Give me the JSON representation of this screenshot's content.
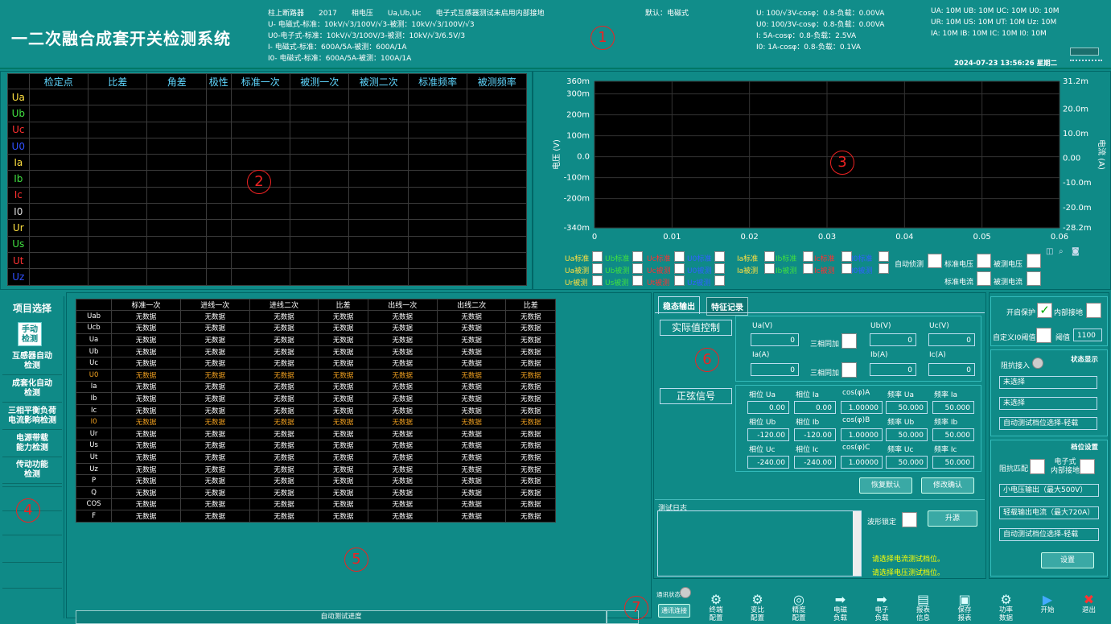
{
  "header": {
    "title": "一二次融合成套开关检测系统",
    "info_col1": [
      "柱上断路器　　2017　　相电压　　Ua,Ub,Uc　　电子式互感器测试未启用内部接地",
      "U-  电磁式-标准：10kV/√3/100V/√3-被测：10kV/√3/100V/√3",
      "U0-电子式-标准：10kV/√3/100V/3-被测：10kV/√3/6.5V/3",
      "I-   电磁式-标准：600A/5A-被测：600A/1A",
      "I0-  电磁式-标准：600A/5A-被测：100A/1A"
    ],
    "default_label": "默认：电磁式",
    "info_col2": [
      "U:   100/√3V-cosφ：0.8-负载：0.00VA",
      "U0:  100/3V-cosφ：0.8-负载：0.00VA",
      "I:    5A-cosφ：0.8-负载：2.5VA",
      "I0:   1A-cosφ：0.8-负载：0.1VA"
    ],
    "info_col3": [
      "UA:  10M   UB:  10M   UC:  10M   U0:  10M",
      "UR:  10M   US:  10M   UT:  10M   Uz:  10M",
      "IA:  10M   IB:  10M   IC:  10M   I0:  10M"
    ],
    "datetime": "2024-07-23   13:56:26   星期二"
  },
  "markers": [
    "1",
    "2",
    "3",
    "4",
    "5",
    "6",
    "7"
  ],
  "result_table": {
    "headers": [
      "",
      "检定点",
      "比差",
      "角差",
      "极性",
      "标准一次",
      "被测一次",
      "被测二次",
      "标准频率",
      "被测频率"
    ],
    "rows": [
      {
        "label": "Ua",
        "color": "#ffe040"
      },
      {
        "label": "Ub",
        "color": "#40e040"
      },
      {
        "label": "Uc",
        "color": "#ff3030"
      },
      {
        "label": "U0",
        "color": "#3050ff"
      },
      {
        "label": "Ia",
        "color": "#ffe040"
      },
      {
        "label": "Ib",
        "color": "#40e040"
      },
      {
        "label": "Ic",
        "color": "#ff3030"
      },
      {
        "label": "I0",
        "color": "#e0e0e0"
      },
      {
        "label": "Ur",
        "color": "#ffe040"
      },
      {
        "label": "Us",
        "color": "#40e040"
      },
      {
        "label": "Ut",
        "color": "#ff3030"
      },
      {
        "label": "Uz",
        "color": "#3050ff"
      }
    ]
  },
  "chart_data": {
    "type": "line",
    "title": "",
    "xlabel": "",
    "ylabel": "电压 (V)",
    "y2label": "电流 (A)",
    "x_ticks": [
      "0",
      "0.01",
      "0.02",
      "0.03",
      "0.04",
      "0.05",
      "0.06"
    ],
    "y_ticks": [
      "360m",
      "300m",
      "200m",
      "100m",
      "0.0",
      "-100m",
      "-200m",
      "-340m"
    ],
    "y2_ticks": [
      "31.2m",
      "20.0m",
      "10.0m",
      "0.00",
      "-10.0m",
      "-20.0m",
      "-28.2m"
    ],
    "ylim": [
      -0.34,
      0.36
    ],
    "y2lim": [
      -0.0282,
      0.0312
    ],
    "xlim": [
      0,
      0.06
    ],
    "series": []
  },
  "legend_checks": {
    "row1": [
      {
        "t": "Ua标准",
        "c": "#ffe040"
      },
      {
        "t": "Ub标准",
        "c": "#40e040"
      },
      {
        "t": "Uc标准",
        "c": "#ff3030"
      },
      {
        "t": "U0标准",
        "c": "#3060ff"
      },
      {
        "t": "Ia标准",
        "c": "#ffe040"
      },
      {
        "t": "Ib标准",
        "c": "#40e040"
      },
      {
        "t": "Ic标准",
        "c": "#ff3030"
      },
      {
        "t": "I0标准",
        "c": "#3060ff"
      }
    ],
    "row2": [
      {
        "t": "Ua被测",
        "c": "#ffe040"
      },
      {
        "t": "Ub被测",
        "c": "#40e040"
      },
      {
        "t": "Uc被测",
        "c": "#ff3030"
      },
      {
        "t": "U0被测",
        "c": "#3060ff"
      },
      {
        "t": "Ia被测",
        "c": "#ffe040"
      },
      {
        "t": "Ib被测",
        "c": "#40e040"
      },
      {
        "t": "Ic被测",
        "c": "#ff3030"
      },
      {
        "t": "I0被测",
        "c": "#3060ff"
      }
    ],
    "row3": [
      {
        "t": "Ur被测",
        "c": "#ffe040"
      },
      {
        "t": "Us被测",
        "c": "#40e040"
      },
      {
        "t": "Ut被测",
        "c": "#ff3030"
      },
      {
        "t": "Uz被测",
        "c": "#3060ff"
      }
    ],
    "auto_measure": "自动侦测",
    "std_voltage": "标准电压",
    "test_voltage": "被测电压",
    "std_current": "标准电流",
    "test_current": "被测电流"
  },
  "menu": {
    "title": "项目选择",
    "items": [
      "手动\n检测",
      "互感器自动\n检测",
      "成套化自动\n检测",
      "三相平衡负荷\n电流影响检测",
      "电源带载\n能力检测",
      "传动功能\n检测"
    ]
  },
  "data_table": {
    "headers": [
      "",
      "标准一次",
      "进线一次",
      "进线二次",
      "比差",
      "出线一次",
      "出线二次",
      "比差"
    ],
    "rows": [
      "Uab",
      "Ucb",
      "Ua",
      "Ub",
      "Uc",
      "U0",
      "Ia",
      "Ib",
      "Ic",
      "I0",
      "Ur",
      "Us",
      "Ut",
      "Uz",
      "P",
      "Q",
      "COS",
      "F"
    ],
    "orange_rows": [
      "U0",
      "I0"
    ],
    "cell": "无数据"
  },
  "progress_label": "自动测试进度",
  "steady": {
    "tabs": [
      "稳态输出",
      "特征记录"
    ],
    "actual_ctrl": "实际值控制",
    "sine_signal": "正弦信号",
    "ua_l": "Ua(V)",
    "ub_l": "Ub(V)",
    "uc_l": "Uc(V)",
    "ia_l": "Ia(A)",
    "ib_l": "Ib(A)",
    "ic_l": "Ic(A)",
    "ua": "0",
    "ub": "0",
    "uc": "0",
    "ia": "0",
    "ib": "0",
    "ic": "0",
    "sync1": "三相同加",
    "sync2": "三相同加",
    "phase_rows": [
      {
        "labels": [
          "相位 Ua",
          "相位 Ia",
          "cos(φ)A",
          "频率 Ua",
          "频率 Ia"
        ],
        "values": [
          "0.00",
          "0.00",
          "1.00000",
          "50.000",
          "50.000"
        ]
      },
      {
        "labels": [
          "相位 Ub",
          "相位 Ib",
          "cos(φ)B",
          "频率 Ub",
          "频率 Ib"
        ],
        "values": [
          "-120.00",
          "-120.00",
          "1.00000",
          "50.000",
          "50.000"
        ]
      },
      {
        "labels": [
          "相位 Uc",
          "相位 Ic",
          "cos(φ)C",
          "频率 Uc",
          "频率 Ic"
        ],
        "values": [
          "-240.00",
          "-240.00",
          "1.00000",
          "50.000",
          "50.000"
        ]
      }
    ],
    "restore_btn": "恢复默认",
    "confirm_btn": "修改确认"
  },
  "log": {
    "title": "测试日志",
    "wave_lock": "波形锁定",
    "raise_btn": "升源",
    "msgs": [
      "请选择电流测试档位。",
      "请选择电压测试档位。"
    ]
  },
  "protect": {
    "enable_label": "开启保护",
    "enable_checked": "✓",
    "internal_ground": "内部接地",
    "custom_i0": "自定义I0阈值",
    "threshold_label": "阈值",
    "threshold": "1100"
  },
  "status": {
    "impedance_in": "阻抗接入",
    "status_title": "状态显示",
    "fields": [
      "未选择",
      "未选择",
      "自动测试档位选择-轻载"
    ]
  },
  "gear": {
    "title": "档位设置",
    "impedance_match": "阻抗匹配",
    "electronic_ground": "电子式\n内部接地",
    "options": [
      "小电压输出（最大500V）",
      "轻载输出电流（最大720A）",
      "自动测试档位选择-轻载"
    ],
    "set_btn": "设置"
  },
  "toolbar": {
    "comm_status": "通讯状态",
    "comm_btn": "通讯连接",
    "items": [
      {
        "label": "终端\n配置",
        "icon": "gear-icon",
        "g": "⚙"
      },
      {
        "label": "变比\n配置",
        "icon": "gears-icon",
        "g": "⚙"
      },
      {
        "label": "精度\n配置",
        "icon": "target-icon",
        "g": "◎"
      },
      {
        "label": "电磁\n负载",
        "icon": "arrow-right-icon",
        "g": "➡"
      },
      {
        "label": "电子\n负载",
        "icon": "arrow-right-icon",
        "g": "➡"
      },
      {
        "label": "报表\n信息",
        "icon": "report-icon",
        "g": "▤"
      },
      {
        "label": "保存\n报表",
        "icon": "save-icon",
        "g": "▣"
      },
      {
        "label": "功率\n数据",
        "icon": "gear-icon",
        "g": "⚙"
      },
      {
        "label": "开始",
        "icon": "play-icon",
        "g": "▶"
      },
      {
        "label": "退出",
        "icon": "close-icon",
        "g": "✖"
      }
    ]
  }
}
